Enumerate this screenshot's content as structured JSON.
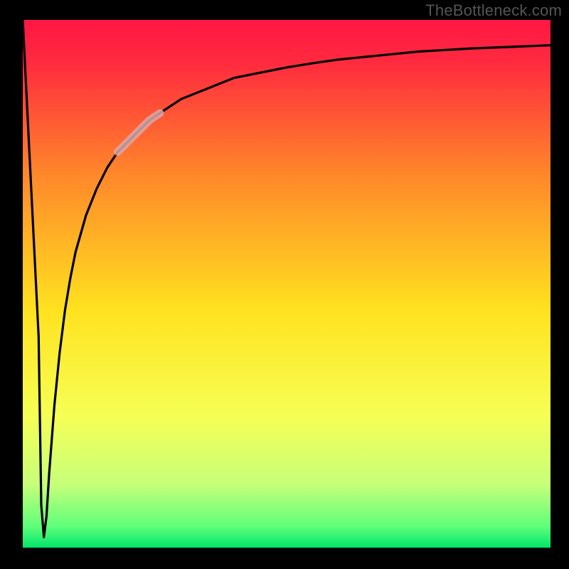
{
  "attribution": "TheBottleneck.com",
  "chart_data": {
    "type": "line",
    "title": "",
    "xlabel": "",
    "ylabel": "",
    "xlim": [
      0,
      100
    ],
    "ylim": [
      0,
      100
    ],
    "series": [
      {
        "name": "bottleneck-curve",
        "x": [
          0,
          3,
          3.5,
          4,
          4.5,
          5,
          6,
          7,
          8,
          9,
          10,
          12,
          14,
          16,
          18,
          20,
          22,
          24,
          27,
          30,
          35,
          40,
          45,
          50,
          55,
          60,
          65,
          70,
          75,
          80,
          85,
          90,
          95,
          100
        ],
        "values": [
          100,
          40,
          8,
          2,
          6,
          14,
          27,
          37,
          45,
          51,
          56,
          63,
          68,
          72,
          75,
          77,
          79,
          81,
          83,
          85,
          87,
          89,
          90,
          91,
          91.8,
          92.5,
          93,
          93.5,
          94,
          94.3,
          94.6,
          94.8,
          95,
          95.2
        ]
      }
    ],
    "annotations": [
      {
        "name": "highlight-segment",
        "x_range": [
          18,
          26
        ],
        "description": "pale/desaturated stroke segment on the rising part of the curve"
      }
    ],
    "background": {
      "type": "vertical-gradient",
      "stops": [
        {
          "pos": 0.0,
          "color": "#ff1744"
        },
        {
          "pos": 0.08,
          "color": "#ff2a3f"
        },
        {
          "pos": 0.3,
          "color": "#ff8a2a"
        },
        {
          "pos": 0.55,
          "color": "#ffe21f"
        },
        {
          "pos": 0.75,
          "color": "#f6ff55"
        },
        {
          "pos": 0.88,
          "color": "#c7ff7a"
        },
        {
          "pos": 0.96,
          "color": "#5fff7a"
        },
        {
          "pos": 1.0,
          "color": "#00e56a"
        }
      ]
    },
    "frame_color": "#000000"
  }
}
